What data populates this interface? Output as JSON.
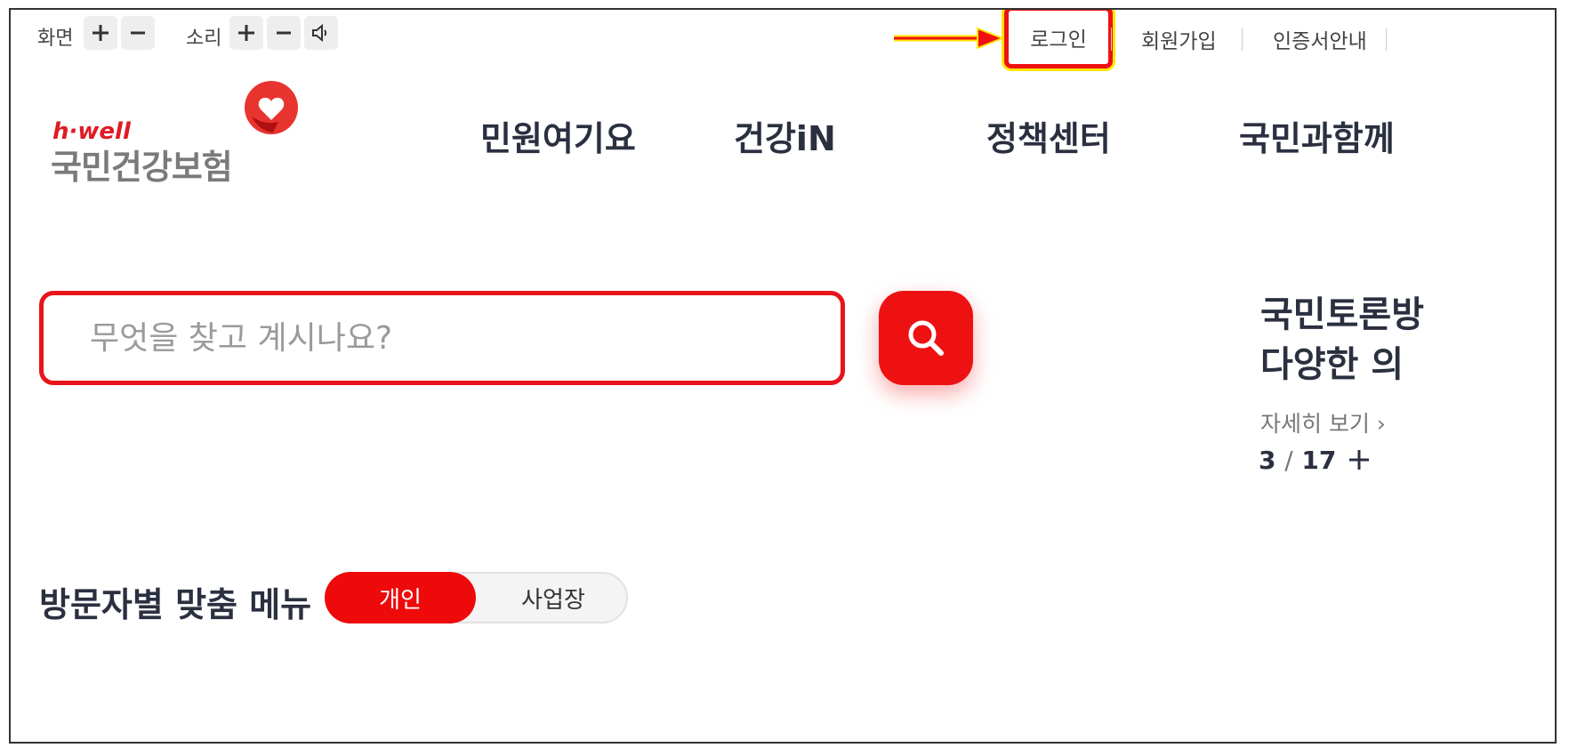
{
  "utility": {
    "screen_label": "화면",
    "sound_label": "소리",
    "links": [
      "로그인",
      "회원가입",
      "인증서안내"
    ]
  },
  "logo": {
    "brand_small": "h·well",
    "brand_name": "국민건강보험"
  },
  "nav": {
    "items": [
      "민원여기요",
      "건강iN",
      "정책센터",
      "국민과함께"
    ]
  },
  "search": {
    "placeholder": "무엇을 찾고 계시나요?"
  },
  "notice": {
    "line1": "국민토론방",
    "line2": "다양한 의",
    "more": "자세히 보기",
    "current": "3",
    "total": "17"
  },
  "visitor_menu": {
    "title": "방문자별 맞춤 메뉴",
    "options": [
      "개인",
      "사업장"
    ],
    "selected": "개인"
  },
  "colors": {
    "accent": "#ee1111",
    "nav_text": "#2b3040",
    "logo_gray": "#7a7a7a",
    "highlight_yellow": "#ffe600"
  }
}
